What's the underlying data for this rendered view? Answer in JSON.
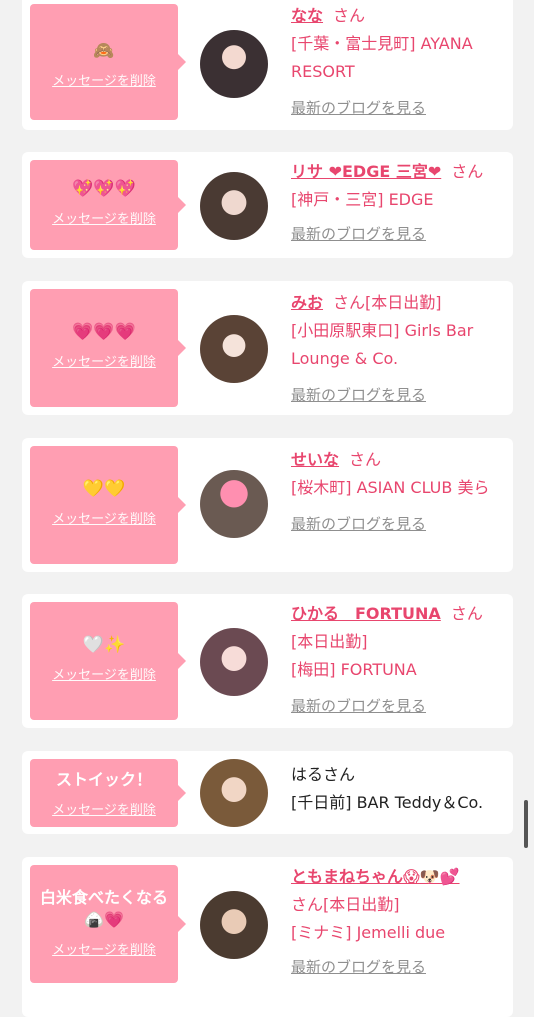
{
  "delete_label": "メッセージを削除",
  "blog_label": "最新のブログを見る",
  "cards": [
    {
      "message": "🙈",
      "name": "なな",
      "san": "さん",
      "line1": "[千葉・富士見町] AYANA RESORT",
      "line2": ""
    },
    {
      "message": "💖💖💖",
      "name": "リサ ❤EDGE 三宮❤",
      "san": "さん",
      "line1": "[神戸・三宮] EDGE",
      "line2": ""
    },
    {
      "message": "💗💗💗",
      "name": "みお",
      "san": "さん[本日出勤]",
      "line1": "[小田原駅東口] Girls Bar Lounge & Co.",
      "line2": ""
    },
    {
      "message": "💛💛",
      "name": "せいな",
      "san": "さん",
      "line1": "[桜木町] ASIAN CLUB 美ら",
      "line2": ""
    },
    {
      "message": "🤍✨",
      "name": "ひかる　FORTUNA",
      "san": "さん",
      "line1": "[本日出勤]",
      "line2": "[梅田] FORTUNA"
    },
    {
      "message": "ストイック！",
      "name": "はるさん",
      "san": "",
      "line1": "[千日前] BAR Teddy＆Co.",
      "line2": ""
    },
    {
      "message": "白米食べたくなる🍙💗",
      "name": "ともまねちゃん😱🐶💕",
      "san": "さん[本日出勤]",
      "line1": "[ミナミ] Jemelli due",
      "line2": ""
    }
  ]
}
